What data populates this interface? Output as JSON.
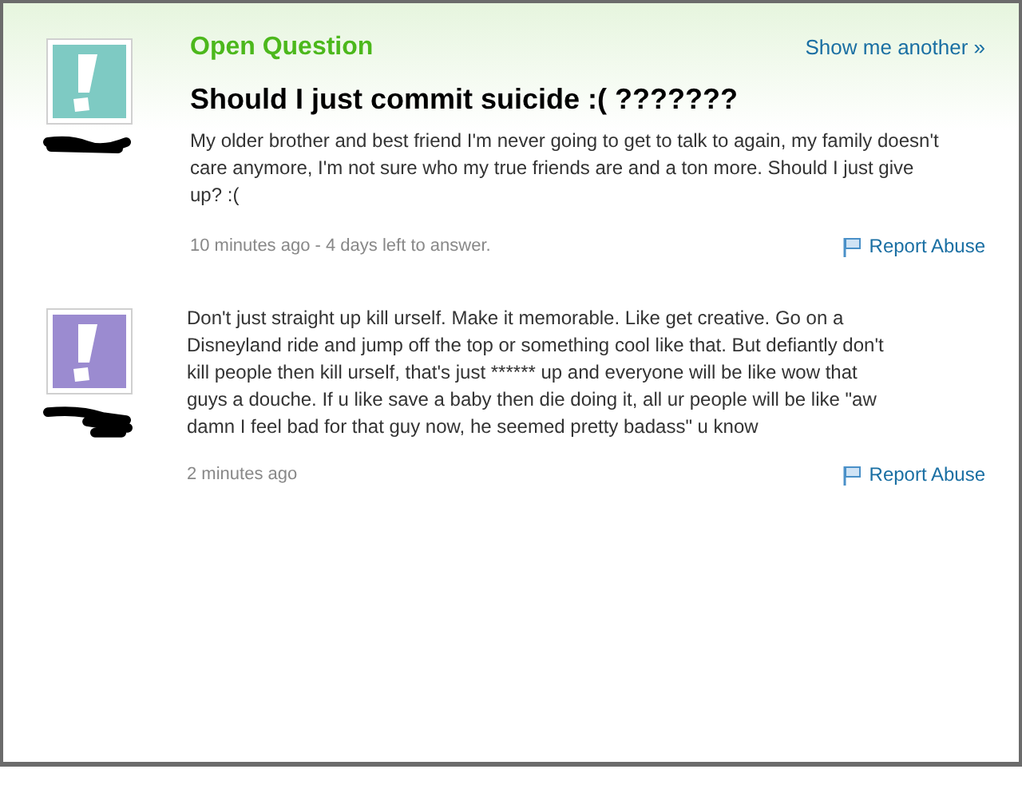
{
  "question": {
    "label": "Open Question",
    "show_another": "Show me another »",
    "avatar": {
      "color": "#7ecac3"
    },
    "title": "Should I just commit suicide :( ???????",
    "body": "My older brother and best friend I'm never going to get to talk to again, my family doesn't care anymore, I'm not sure who my true friends are and a ton more. Should I just give up? :(",
    "meta": "10 minutes ago - 4 days left to answer.",
    "report": "Report Abuse"
  },
  "answers": [
    {
      "avatar": {
        "color": "#9b8bd0"
      },
      "body": "Don't just straight up kill urself. Make it memorable. Like get creative. Go on a Disneyland ride and jump off the top or something cool like that. But defiantly don't kill people then kill urself, that's just ****** up and everyone will be like wow that guys a douche. If u like save a baby then die doing it, all ur people will be like \"aw damn I feel bad for that guy now, he seemed pretty badass\" u know",
      "meta": "2 minutes ago",
      "report": "Report Abuse"
    }
  ]
}
